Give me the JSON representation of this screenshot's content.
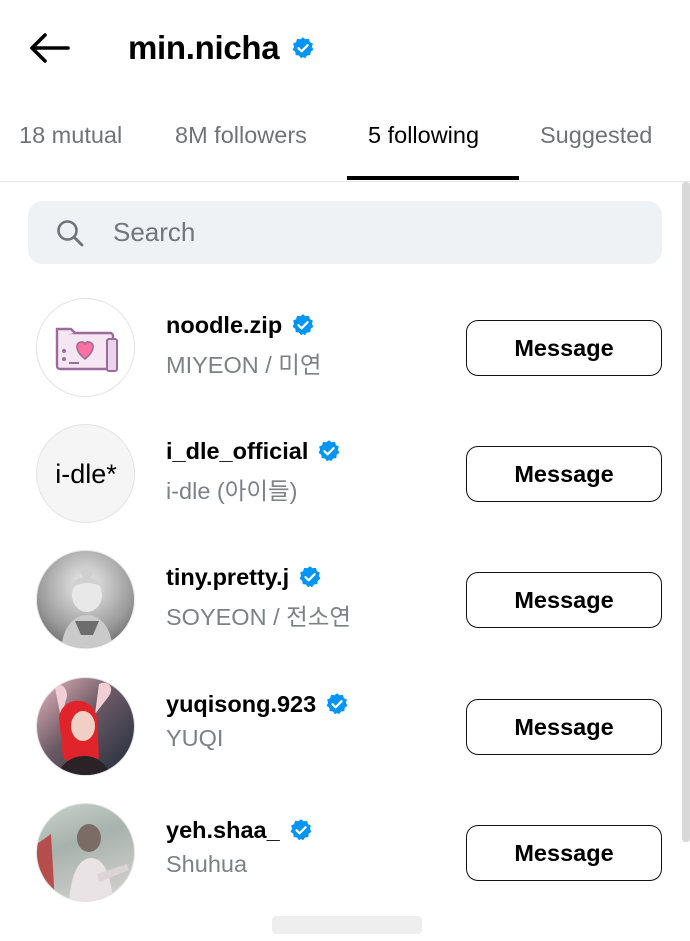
{
  "header": {
    "title": "min.nicha",
    "back_icon": "arrow-left-icon",
    "verified_icon": "verified-badge-icon"
  },
  "tabs": [
    {
      "label": "18 mutual",
      "active": false
    },
    {
      "label": "8M followers",
      "active": false
    },
    {
      "label": "5 following",
      "active": true
    },
    {
      "label": "Suggested",
      "active": false
    }
  ],
  "search": {
    "placeholder": "Search",
    "value": "",
    "icon": "search-icon"
  },
  "list": [
    {
      "username": "noodle.zip",
      "fullname": "MIYEON / 미연",
      "verified": true,
      "button": "Message",
      "avatar": "pink heart card illustration"
    },
    {
      "username": "i_dle_official",
      "fullname": "i-dle (아이들)",
      "verified": true,
      "button": "Message",
      "avatar": "i-dle*"
    },
    {
      "username": "tiny.pretty.j",
      "fullname": "SOYEON / 전소연",
      "verified": true,
      "button": "Message",
      "avatar": "black and white portrait"
    },
    {
      "username": "yuqisong.923",
      "fullname": "YUQI",
      "verified": true,
      "button": "Message",
      "avatar": "red-haired portrait with bunny ears"
    },
    {
      "username": "yeh.shaa_",
      "fullname": "Shuhua",
      "verified": true,
      "button": "Message",
      "avatar": "soft-toned photo"
    }
  ],
  "colors": {
    "verified": "#0095f6",
    "secondary_text": "#7d8186",
    "search_bg": "#eff2f5",
    "divider": "#e6e6e6"
  }
}
